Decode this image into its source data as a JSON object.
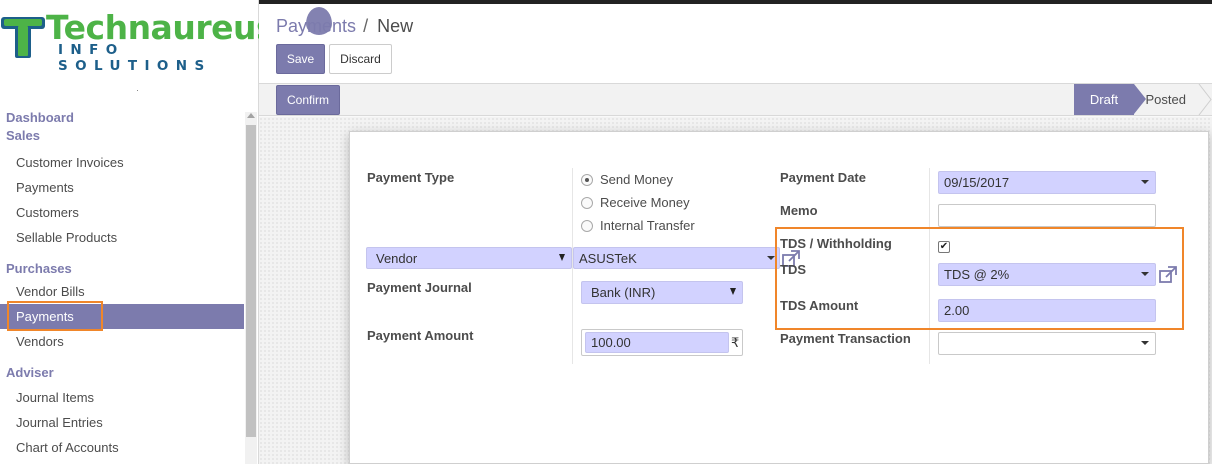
{
  "brand": {
    "name_top": "Technaureus",
    "name_bottom": "INFO SOLUTIONS",
    "colors": {
      "green": "#4db347",
      "blue": "#1d5f8a"
    }
  },
  "sidebar": {
    "sections": [
      {
        "title": "Dashboard"
      },
      {
        "title": "Sales",
        "items": [
          "Customer Invoices",
          "Payments",
          "Customers",
          "Sellable Products"
        ]
      },
      {
        "title": "Purchases",
        "items": [
          "Vendor Bills",
          "Payments",
          "Vendors"
        ]
      },
      {
        "title": "Adviser",
        "items": [
          "Journal Items",
          "Journal Entries",
          "Chart of Accounts"
        ]
      }
    ],
    "active_item": "Payments"
  },
  "breadcrumb": {
    "parent": "Payments",
    "separator": "/",
    "current": "New"
  },
  "buttons": {
    "save": "Save",
    "discard": "Discard",
    "confirm": "Confirm"
  },
  "status": {
    "draft": "Draft",
    "posted": "Posted",
    "current": "Draft"
  },
  "form": {
    "payment_type_label": "Payment Type",
    "payment_type_options": [
      "Send Money",
      "Receive Money",
      "Internal Transfer"
    ],
    "payment_type_selected": "Send Money",
    "partner_type": "Vendor",
    "partner": "ASUSTeK",
    "payment_journal_label": "Payment Journal",
    "payment_journal": "Bank (INR)",
    "payment_amount_label": "Payment Amount",
    "payment_amount": "100.00",
    "currency_symbol": "₹",
    "payment_date_label": "Payment Date",
    "payment_date": "09/15/2017",
    "memo_label": "Memo",
    "memo": "",
    "tds_withholding_label": "TDS / Withholding",
    "tds_withholding_checked": true,
    "tds_label": "TDS",
    "tds": "TDS @ 2%",
    "tds_amount_label": "TDS Amount",
    "tds_amount": "2.00",
    "payment_transaction_label": "Payment Transaction",
    "payment_transaction": ""
  },
  "colors": {
    "accent": "#7c7bad",
    "highlight": "#f0862a",
    "field_bg": "#d2d2ff"
  }
}
